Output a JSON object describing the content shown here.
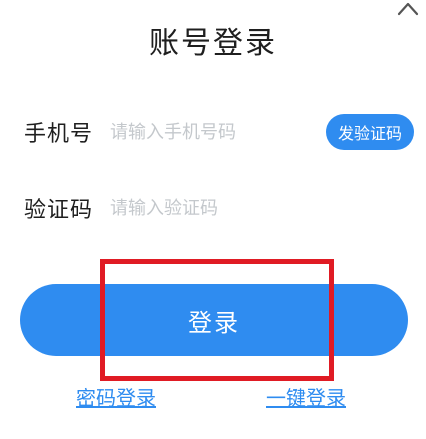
{
  "header": {
    "title": "账号登录",
    "collapse_icon": "chevron-up-icon"
  },
  "form": {
    "phone": {
      "label": "手机号",
      "placeholder": "请输入手机号码",
      "value": ""
    },
    "send_code_label": "发验证码",
    "code": {
      "label": "验证码",
      "placeholder": "请输入验证码",
      "value": ""
    },
    "login_label": "登录"
  },
  "links": {
    "password_login": "密码登录",
    "onekey_login": "一键登录"
  },
  "colors": {
    "accent": "#2f8cf0",
    "highlight": "#e01b24",
    "placeholder": "#c4c8cc"
  }
}
